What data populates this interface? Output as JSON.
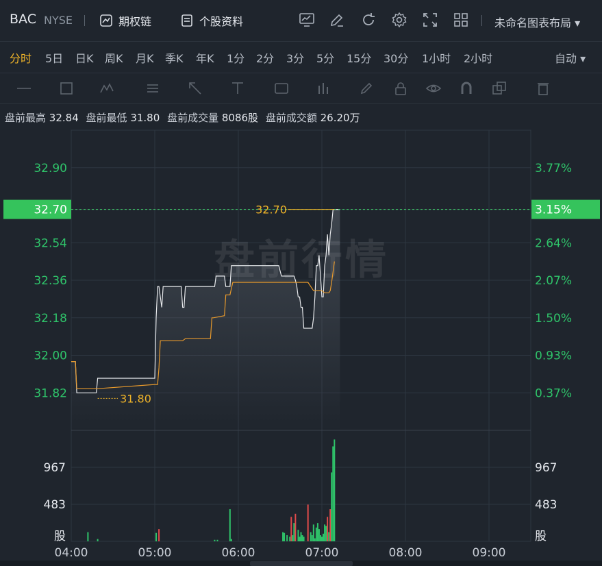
{
  "header": {
    "symbol": "BAC",
    "exchange": "NYSE",
    "options_chain_label": "期权链",
    "stock_info_label": "个股资料",
    "layout_label": "未命名图表布局 ▾"
  },
  "periods": {
    "items": [
      "分时",
      "5日",
      "日K",
      "周K",
      "月K",
      "季K",
      "年K",
      "1分",
      "2分",
      "3分",
      "5分",
      "15分",
      "30分",
      "1小时",
      "2小时"
    ],
    "active_index": 0,
    "auto_label": "自动 ▾"
  },
  "drawing_tools": [
    "line-tool-icon",
    "rect-tool-icon",
    "wave-tool-icon",
    "text-list-icon",
    "arrow-tool-icon",
    "measure-tool-icon",
    "label-tool-icon",
    "bar-tool-icon",
    "pen-tool-icon",
    "lock-icon",
    "eye-icon",
    "magnet-icon",
    "copy-icon",
    "trash-icon"
  ],
  "stats": {
    "high_label": "盘前最高",
    "high_value": "32.84",
    "low_label": "盘前最低",
    "low_value": "31.80",
    "volume_label": "盘前成交量",
    "volume_value": "8086股",
    "amount_label": "盘前成交额",
    "amount_value": "26.20万"
  },
  "watermark": "盘前行情",
  "colors": {
    "accent": "#f0b429",
    "up": "#2fc46a",
    "down": "#e04b4b",
    "price_tag_bg": "#35c35c",
    "grid": "#2e3641",
    "price_line": "#e8eaed",
    "avg_line": "#e89a2c"
  },
  "chart_data": {
    "type": "line",
    "price_axis": {
      "left_ticks": [
        "32.90",
        "32.70",
        "32.54",
        "32.36",
        "32.18",
        "32.00",
        "31.82"
      ],
      "right_ticks": [
        "3.77%",
        "3.15%",
        "2.64%",
        "2.07%",
        "1.50%",
        "0.93%",
        "0.37%"
      ],
      "tick_values": [
        32.9,
        32.7,
        32.54,
        32.36,
        32.18,
        32.0,
        31.82
      ],
      "ylim": [
        31.64,
        33.08
      ]
    },
    "current_price": "32.70",
    "current_pct": "3.15%",
    "max_label": "32.70",
    "min_label": "31.80",
    "x_ticks": [
      "04:00",
      "05:00",
      "06:00",
      "07:00",
      "08:00",
      "09:00"
    ],
    "x_tick_minutes": [
      0,
      60,
      120,
      180,
      240,
      300
    ],
    "xlim": [
      0,
      330
    ],
    "price_series": {
      "name": "",
      "x": [
        0,
        3,
        4,
        18,
        19,
        60,
        61,
        62,
        63,
        64,
        65,
        66,
        67,
        68,
        79,
        80,
        81,
        82,
        93,
        94,
        102,
        103,
        104,
        110,
        111,
        112,
        113,
        114,
        115,
        116,
        126,
        127,
        148,
        149,
        151,
        153,
        155,
        157,
        159,
        160,
        161,
        162,
        163,
        164,
        165,
        166,
        167,
        170,
        172,
        173,
        174,
        175,
        176,
        177,
        178,
        179,
        180,
        181,
        182,
        183,
        184,
        185,
        186,
        187,
        188,
        189,
        189,
        190,
        191,
        192,
        193,
        193,
        193,
        193
      ],
      "y": [
        31.97,
        31.97,
        31.82,
        31.82,
        31.89,
        31.89,
        32.18,
        32.33,
        32.33,
        32.28,
        32.23,
        32.33,
        32.33,
        32.33,
        32.33,
        32.23,
        32.23,
        32.33,
        32.33,
        32.33,
        32.33,
        32.33,
        32.38,
        32.38,
        32.33,
        32.33,
        32.33,
        32.33,
        32.43,
        32.43,
        32.43,
        32.43,
        32.43,
        32.43,
        32.38,
        32.38,
        32.38,
        32.38,
        32.38,
        32.38,
        32.36,
        32.33,
        32.28,
        32.28,
        32.23,
        32.23,
        32.13,
        32.13,
        32.13,
        32.13,
        32.18,
        32.28,
        32.43,
        32.43,
        32.48,
        32.38,
        32.28,
        32.28,
        32.43,
        32.48,
        32.58,
        32.48,
        32.58,
        32.63,
        32.7,
        32.7,
        32.7,
        32.7,
        32.7,
        32.7,
        32.7,
        32.7,
        32.7,
        32.7
      ]
    },
    "avg_series": {
      "name": "",
      "x": [
        0,
        3,
        4,
        19,
        60,
        62,
        63,
        64,
        70,
        80,
        82,
        100,
        101,
        102,
        110,
        111,
        112,
        114,
        116,
        150,
        170,
        172,
        174,
        176,
        180,
        182,
        184,
        185,
        186,
        187,
        188,
        189
      ],
      "y": [
        31.97,
        31.97,
        31.84,
        31.84,
        31.86,
        31.86,
        31.94,
        32.07,
        32.07,
        32.07,
        32.08,
        32.08,
        32.18,
        32.18,
        32.19,
        32.29,
        32.29,
        32.29,
        32.35,
        32.35,
        32.35,
        32.33,
        32.31,
        32.31,
        32.31,
        32.3,
        32.3,
        32.3,
        32.31,
        32.35,
        32.4,
        32.45
      ]
    },
    "volume_axis": {
      "left_ticks": [
        "967",
        "483",
        "股"
      ],
      "right_ticks": [
        "967",
        "483",
        "股"
      ],
      "tick_values": [
        967,
        483,
        0
      ],
      "ylim": [
        0,
        1450
      ]
    },
    "volume_series": {
      "x": [
        12,
        19,
        61,
        63,
        103,
        105,
        114,
        115,
        152,
        153,
        155,
        157,
        158,
        159,
        160,
        161,
        163,
        164,
        165,
        166,
        167,
        170,
        172,
        173,
        174,
        175,
        176,
        177,
        178,
        179,
        180,
        181,
        182,
        183,
        184,
        185,
        186,
        187,
        188,
        189
      ],
      "values": [
        120,
        30,
        110,
        160,
        20,
        20,
        420,
        30,
        120,
        110,
        80,
        60,
        320,
        80,
        240,
        360,
        150,
        60,
        120,
        80,
        60,
        480,
        120,
        80,
        220,
        40,
        180,
        240,
        160,
        80,
        60,
        100,
        220,
        200,
        320,
        120,
        420,
        900,
        1240,
        1330
      ],
      "directions": [
        "up",
        "up",
        "up",
        "down",
        "up",
        "up",
        "up",
        "up",
        "up",
        "up",
        "up",
        "up",
        "down",
        "up",
        "up",
        "down",
        "up",
        "up",
        "up",
        "up",
        "up",
        "down",
        "up",
        "up",
        "up",
        "up",
        "up",
        "up",
        "up",
        "up",
        "up",
        "up",
        "up",
        "up",
        "down",
        "up",
        "down",
        "up",
        "up",
        "up"
      ]
    }
  }
}
